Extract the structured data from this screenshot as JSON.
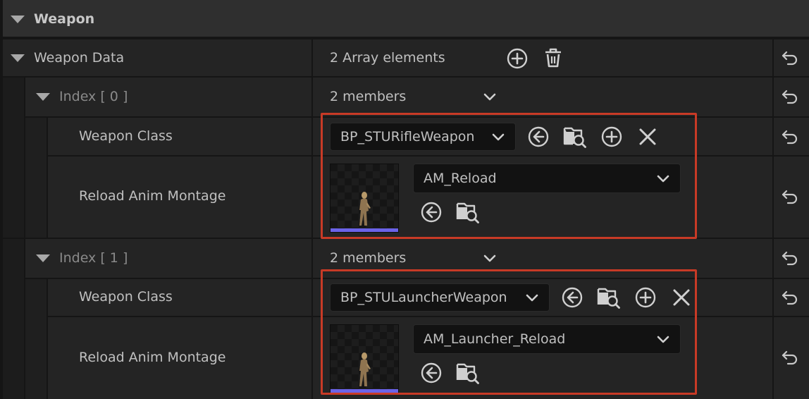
{
  "section": {
    "title": "Weapon"
  },
  "weapon_data": {
    "label": "Weapon Data",
    "summary": "2 Array elements"
  },
  "elements": [
    {
      "index_label": "Index",
      "index_value": "[ 0 ]",
      "members": "2 members",
      "weapon_class_label": "Weapon Class",
      "weapon_class_value": "BP_STURifleWeapon",
      "montage_label": "Reload Anim Montage",
      "montage_value": "AM_Reload"
    },
    {
      "index_label": "Index",
      "index_value": "[ 1 ]",
      "members": "2 members",
      "weapon_class_label": "Weapon Class",
      "weapon_class_value": "BP_STULauncherWeapon",
      "montage_label": "Reload Anim Montage",
      "montage_value": "AM_Launcher_Reload"
    }
  ],
  "colors": {
    "highlight": "#c83a26",
    "thumbnail_bar": "#6b63e8",
    "row_bg": "#242424",
    "header_bg": "#2f2f2f"
  },
  "icons": {
    "expand": "triangle-down-icon",
    "reset": "reset-to-default-icon",
    "add": "plus-circle-icon",
    "delete": "trash-icon",
    "use_selected": "arrow-left-circle-icon",
    "browse": "folder-search-icon",
    "insert": "plus-circle-icon",
    "clear": "close-icon",
    "dropdown": "chevron-down-icon"
  }
}
